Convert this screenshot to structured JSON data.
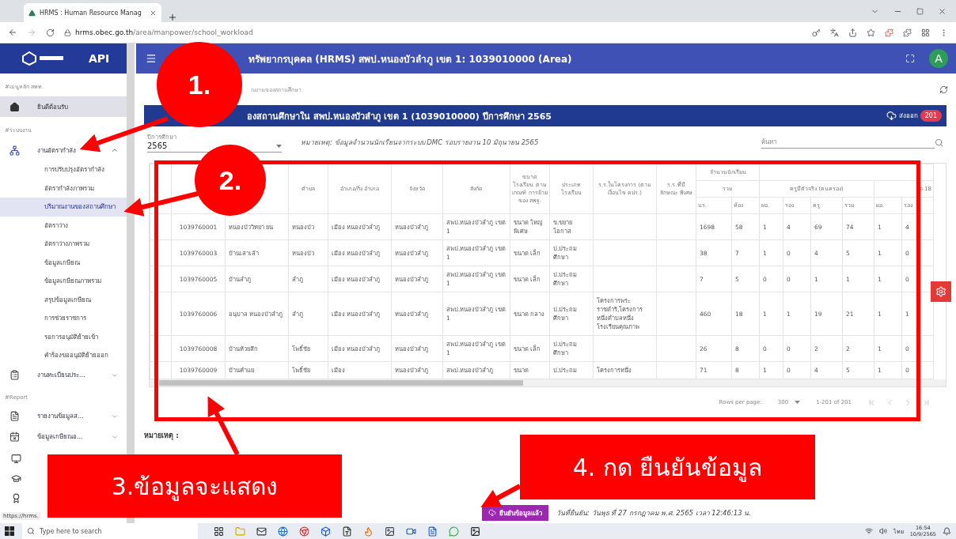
{
  "browser": {
    "tab_title": "HRMS : Human Resource Manag",
    "url_host": "hrms.obec.go.th",
    "url_path": "/area/manpower/school_workload"
  },
  "sidebar": {
    "brand": "API",
    "sections": [
      {
        "label": "#เมนูหลัก สพท.",
        "items": [
          {
            "label": "ยินดีต้อนรับ",
            "selected": true
          }
        ]
      },
      {
        "label": "#ระบบงาน",
        "items": [
          {
            "label": "งานอัตรากำลัง",
            "selected": false,
            "expanded": true,
            "children": [
              {
                "label": "การปรับปรุงอัตรากำลัง",
                "selected": false
              },
              {
                "label": "อัตรากำลังภาพรวม",
                "selected": false
              },
              {
                "label": "ปริมาณงานของสถานศึกษา",
                "selected": true
              },
              {
                "label": "อัตราว่าง",
                "selected": false
              },
              {
                "label": "อัตราว่างภาพรวม",
                "selected": false
              },
              {
                "label": "ข้อมูลเกษียณ",
                "selected": false
              },
              {
                "label": "ข้อมูลเกษียณภาพรวม",
                "selected": false
              },
              {
                "label": "สรุปข้อมูลเกษียณ",
                "selected": false
              },
              {
                "label": "การช่วยราชการ",
                "selected": false
              },
              {
                "label": "รอการอนุมัติย้ายเข้า",
                "selected": false
              },
              {
                "label": "คำร้องขออนุมัติย้ายออก",
                "selected": false
              }
            ]
          },
          {
            "label": "งานทะเบียนประ...",
            "selected": false,
            "expanded": false
          }
        ]
      },
      {
        "label": "#Report",
        "items": [
          {
            "label": "รายงานข้อมูลส...",
            "selected": false,
            "expanded": false
          },
          {
            "label": "ข้อมูลเกษียณอ...",
            "selected": false,
            "expanded": false
          }
        ]
      }
    ]
  },
  "status_url": "https://hrms.",
  "header": {
    "title": "ทรัพยากรบุคคล (HRMS) สพป.หนองบัวลำภู เขต 1: 1039010000 (Area)",
    "avatar": "A"
  },
  "breadcrumb": "ณงานของสถานศึกษา",
  "card": {
    "title": "องสถานศึกษาใน สพป.หนองบัวลำภู เขต 1 (1039010000) ปีการศึกษา 2565",
    "export_label": "ส่งออก",
    "export_count": "201"
  },
  "filters": {
    "year_label": "ปีการศึกษา",
    "year": "2565",
    "note": "หมายเหตุ: ข้อมูลจำนวนนักเรียนจากระบบ DMC รอบรายงาน 10 มิถุนายน 2565",
    "search_placeholder": "ค้นหา"
  },
  "table": {
    "header_cells": [
      null,
      null,
      null,
      "ตำบล",
      "อำเภอ/กิ่ง อำเภอ",
      "จังหวัด",
      "สังกัด",
      "ขนาด โรงเรียน ตาม เกณฑ์ การย้าย ของ สพฐ.",
      "ประเภท โรงเรียน",
      "ร.ร.ในโครงการ (ตามเงื่อนไข คปร.)",
      "ร.ร.ที่มี ลักษณะ พิเศษ"
    ],
    "student_group": "จำนวนนักเรียน",
    "total_group": "รวม",
    "teacher_group": "ครูมีตัวจริง (คนครอง)",
    "clipped_group": "จ.18",
    "sub_columns": [
      "นร.",
      "ห้อง",
      "ผอ.",
      "รอง",
      "ครู",
      "รวม",
      "ผอ.",
      "รอง"
    ],
    "rows": [
      {
        "cells": [
          null,
          "1039760001",
          "หนองบัววิทยา ยน",
          "หนองบัว",
          "เมือง หนองบัวลำภู",
          "หนองบัวลำภู",
          "สพป.หนองบัวลำภู เขต 1",
          "ขนาด ใหญ่ พิเศษ",
          "ข.ขยาย โอกาส",
          null,
          null,
          "1698",
          "58",
          "1",
          "4",
          "69",
          "74",
          "1",
          "4"
        ]
      },
      {
        "cells": [
          null,
          "1039760003",
          "บ้านเสาเล้า",
          "หนองบัว",
          "เมือง หนองบัวลำภู",
          "หนองบัวลำภู",
          "สพป.หนองบัวลำภู เขต 1",
          "ขนาด เล็ก",
          "ป.ประถม ศึกษา",
          null,
          null,
          "38",
          "7",
          "1",
          "0",
          "4",
          "5",
          "1",
          "0"
        ]
      },
      {
        "cells": [
          null,
          "1039760005",
          "บ้านลำภู",
          "ลำภู",
          "เมือง หนองบัวลำภู",
          "หนองบัวลำภู",
          "สพป.หนองบัวลำภู เขต 1",
          "ขนาด เล็ก",
          "ป.ประถม ศึกษา",
          null,
          null,
          "7",
          "5",
          "0",
          "0",
          "1",
          "1",
          "1",
          "0"
        ]
      },
      {
        "cells": [
          null,
          "1039760006",
          "อนุบาล หนองบัวลำภู",
          "ลำภู",
          "เมือง หนองบัวลำภู",
          "หนองบัวลำภู",
          "สพป.หนองบัวลำภู เขต 1",
          "ขนาด กลาง",
          "ป.ประถม ศึกษา",
          "โครงการพระ ราชดำริ,โครงการ หนึ่งตำบลหนึ่ง โรงเรียนคุณภาพ",
          null,
          "460",
          "18",
          "1",
          "1",
          "19",
          "21",
          "1",
          "1"
        ]
      },
      {
        "cells": [
          null,
          "1039760008",
          "บ้านห้วยลึก",
          "โพธิ์ชัย",
          "เมือง หนองบัวลำภู",
          "หนองบัวลำภู",
          "สพป.หนองบัวลำภู เขต 1",
          "ขนาด เล็ก",
          "ป.ประถม ศึกษา",
          null,
          null,
          "26",
          "8",
          "0",
          "0",
          "2",
          "2",
          "1",
          "0"
        ]
      },
      {
        "cells": [
          null,
          "1039760009",
          "บ้านคำแย",
          "โพธิ์ชัย",
          "เมือง",
          "หนองบัวลำภู",
          "สพป.หนองบัวลำภู",
          "ขนาด",
          "ป.ประถม",
          "โครงการหนึ่ง",
          null,
          "71",
          "8",
          "1",
          "0",
          "4",
          "5",
          "1",
          "0"
        ]
      }
    ]
  },
  "pagination": {
    "rows_per_page_label": "Rows per page:",
    "rows_per_page": "300",
    "range": "1-201 of 201"
  },
  "remark_label": "หมายเหตุ :",
  "confirm": {
    "button": "ยืนยันข้อมูลแล้ว",
    "date": "วันที่ยืนยัน: วันพุธ ที่ 27 กรกฎาคม พ.ศ. 2565 เวลา 12:46:13 น."
  },
  "taskbar": {
    "search_placeholder": "Type here to search",
    "language": "ไทย",
    "time": "16:54",
    "date": "10/9/2565"
  },
  "annotations": [
    {
      "kind": "circle",
      "label": "1."
    },
    {
      "kind": "circle",
      "label": "2."
    },
    {
      "kind": "box",
      "label": "3.ข้อมูลจะแสดง"
    },
    {
      "kind": "box",
      "label": "4. กด ยืนยันข้อมูล"
    }
  ]
}
